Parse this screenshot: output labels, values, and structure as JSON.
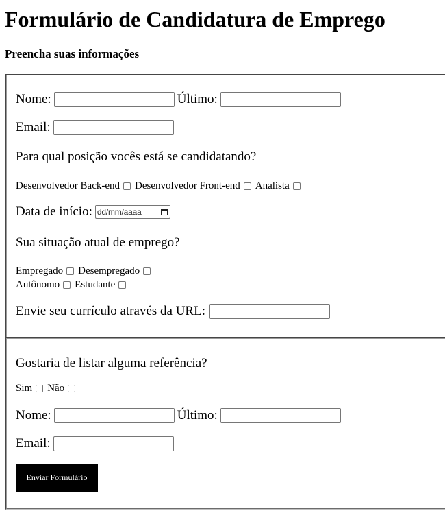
{
  "header": {
    "title": "Formulário de Candidatura de Emprego",
    "subtitle": "Preencha suas informações"
  },
  "applicant": {
    "first_name_label": "Nome:",
    "first_name_value": "",
    "last_name_label": "Último:",
    "last_name_value": "",
    "email_label": "Email:",
    "email_value": "",
    "position_question": "Para qual posição vocês está se candidatando?",
    "positions": [
      {
        "label": "Desenvolvedor Back-end",
        "checked": false
      },
      {
        "label": "Desenvolvedor Front-end",
        "checked": false
      },
      {
        "label": "Analista",
        "checked": false
      }
    ],
    "start_date_label": "Data de início:",
    "start_date_placeholder": "dd/mm/aaaa",
    "employment_question": "Sua situação atual de emprego?",
    "employment_options": [
      {
        "label": "Empregado",
        "checked": false
      },
      {
        "label": "Desempregado",
        "checked": false
      },
      {
        "label": "Autônomo",
        "checked": false
      },
      {
        "label": "Estudante",
        "checked": false
      }
    ],
    "resume_label": "Envie seu currículo através da URL:",
    "resume_value": ""
  },
  "reference": {
    "question": "Gostaria de listar alguma referência?",
    "options": [
      {
        "label": "Sim",
        "checked": false
      },
      {
        "label": "Não",
        "checked": false
      }
    ],
    "first_name_label": "Nome:",
    "first_name_value": "",
    "last_name_label": "Último:",
    "last_name_value": "",
    "email_label": "Email:",
    "email_value": ""
  },
  "submit_label": "Enviar Formulário"
}
